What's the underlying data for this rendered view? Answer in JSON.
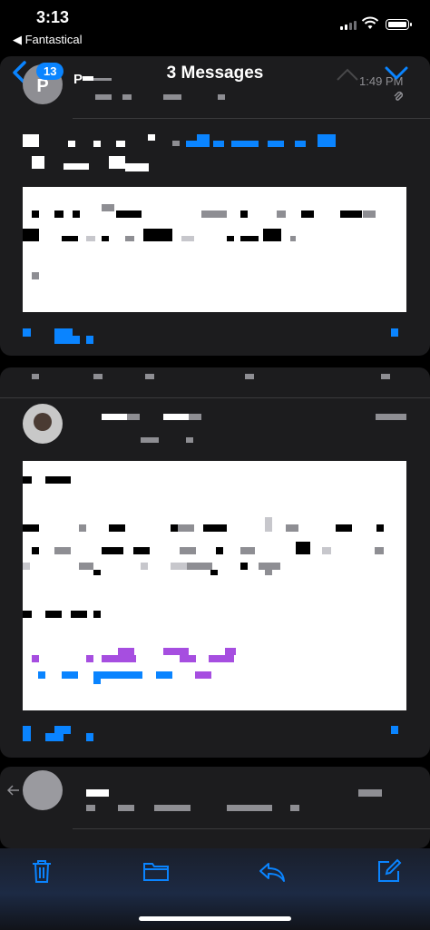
{
  "status_bar": {
    "time": "3:13",
    "back_app": "◀ Fantastical"
  },
  "nav": {
    "title": "3 Messages",
    "unread_badge": "13"
  },
  "message1": {
    "avatar_initial": "P",
    "sender": "P",
    "timestamp": "1:49 PM"
  },
  "colors": {
    "accent": "#0a84ff",
    "card_bg": "#1c1c1e",
    "background": "#000000",
    "secondary_text": "#8e8e93"
  },
  "icons": [
    "back-chevron-icon",
    "up-chevron-icon",
    "down-chevron-icon",
    "attachment-icon",
    "reply-icon",
    "trash-icon",
    "folder-icon",
    "reply-arrow-icon",
    "compose-icon"
  ]
}
